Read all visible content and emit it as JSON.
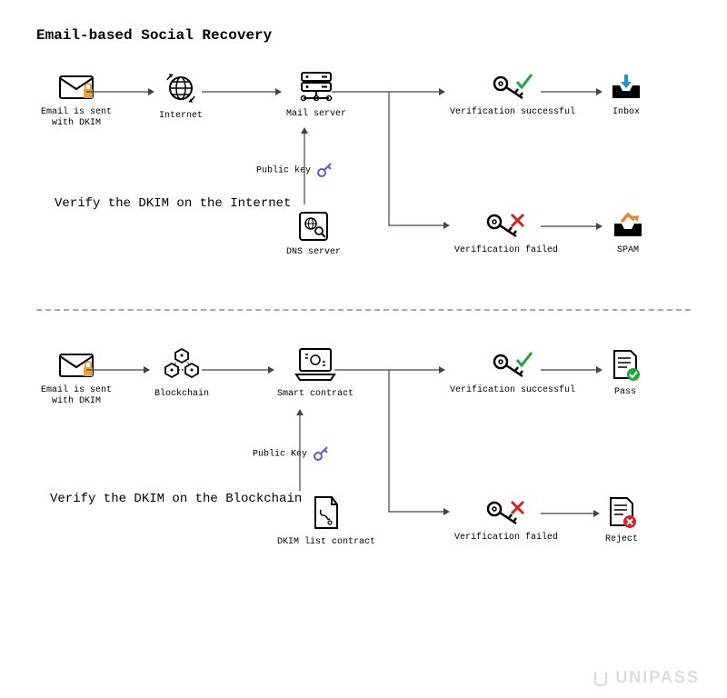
{
  "title": "Email-based Social Recovery",
  "top": {
    "email": "Email is sent\nwith DKIM",
    "internet": "Internet",
    "mailserver": "Mail server",
    "dns": "DNS server",
    "pubkey": "Public key",
    "success": "Verification successful",
    "fail": "Verification failed",
    "inbox": "Inbox",
    "spam": "SPAM",
    "caption": "Verify the DKIM\non the Internet"
  },
  "bottom": {
    "email": "Email is sent\nwith DKIM",
    "blockchain": "Blockchain",
    "contract": "Smart contract",
    "dkimlist": "DKIM list contract",
    "pubkey": "Public Key",
    "success": "Verification successful",
    "fail": "Verification failed",
    "pass": "Pass",
    "reject": "Reject",
    "caption": "Verify the DKIM\non the Blockchain"
  },
  "brand": "UNIPASS"
}
